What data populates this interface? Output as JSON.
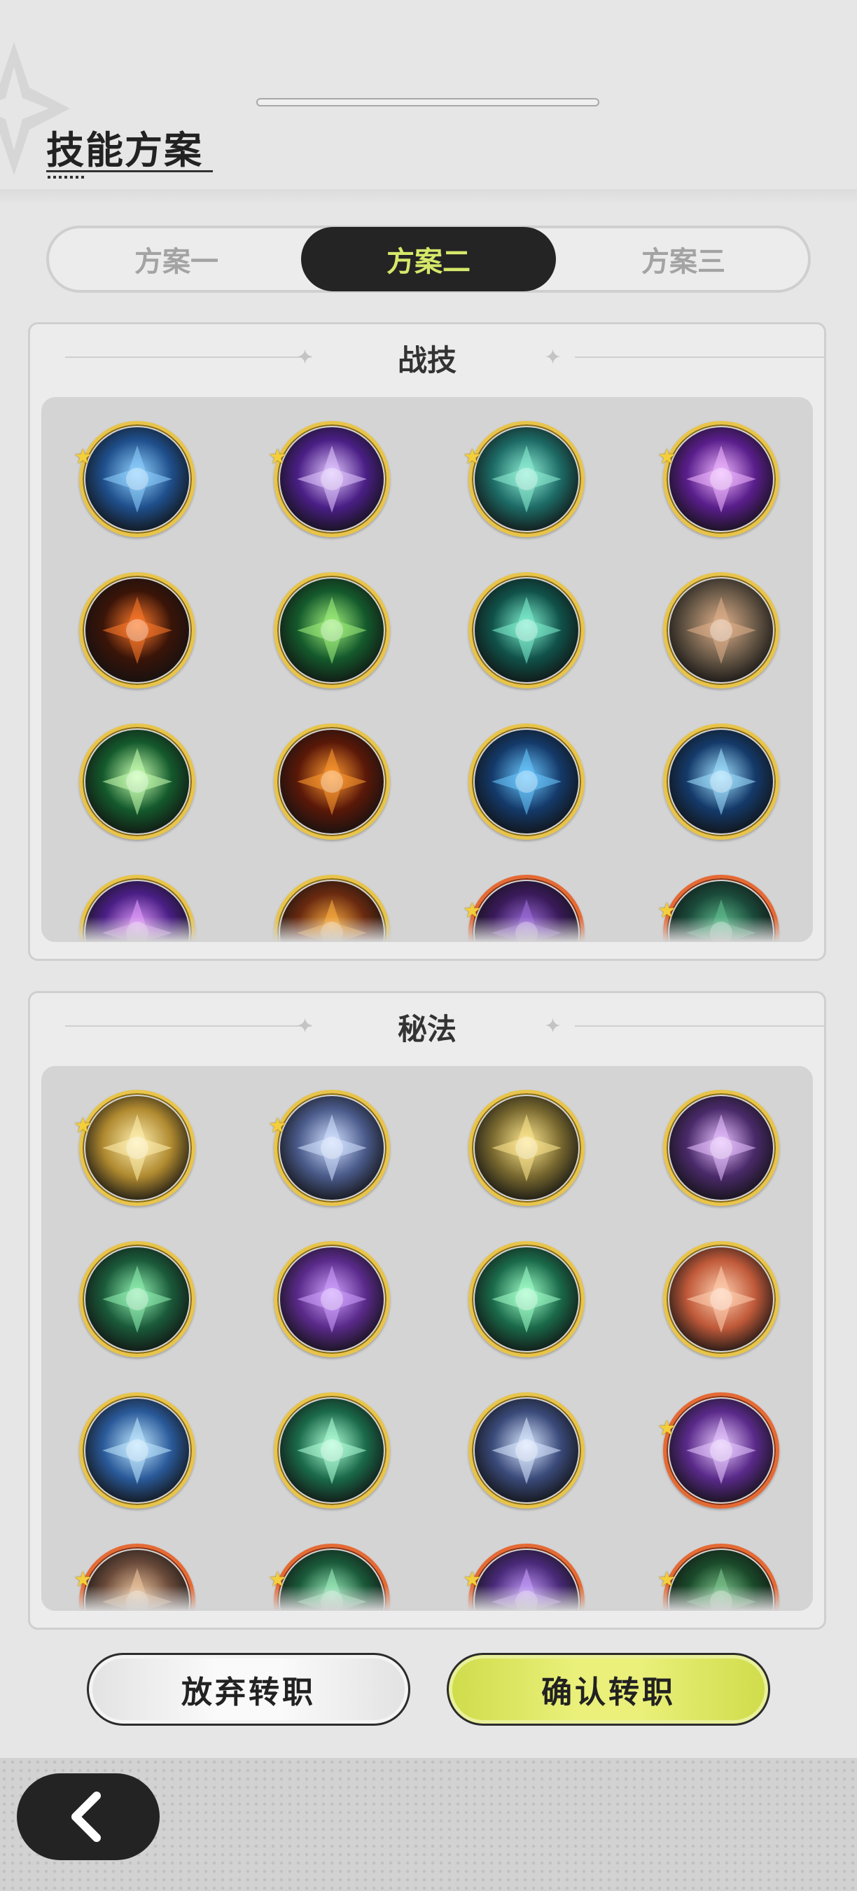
{
  "header": {
    "title": "技能方案"
  },
  "tabs": [
    {
      "label": "方案一",
      "active": false
    },
    {
      "label": "方案二",
      "active": true
    },
    {
      "label": "方案三",
      "active": false
    }
  ],
  "combat": {
    "title": "战技",
    "icons": [
      {
        "name": "ice-burst-skill-icon",
        "starred": true,
        "frame": "gold",
        "bg": "#1f4f8c",
        "fg": "#8fd2ff"
      },
      {
        "name": "purple-star-skill-icon",
        "starred": true,
        "frame": "gold",
        "bg": "#4a1f86",
        "fg": "#e2c6ff"
      },
      {
        "name": "wind-vortex-skill-icon",
        "starred": true,
        "frame": "gold",
        "bg": "#1d6b66",
        "fg": "#8ff0d6"
      },
      {
        "name": "violet-burst-skill-icon",
        "starred": true,
        "frame": "gold",
        "bg": "#5a1e8c",
        "fg": "#f0b6ff"
      },
      {
        "name": "fire-swirl-skill-icon",
        "starred": false,
        "frame": "gold",
        "bg": "#3a1408",
        "fg": "#ff7a2a"
      },
      {
        "name": "green-comet-skill-icon",
        "starred": false,
        "frame": "gold",
        "bg": "#145a2c",
        "fg": "#9ff07a"
      },
      {
        "name": "teal-slash-skill-icon",
        "starred": false,
        "frame": "gold",
        "bg": "#10524a",
        "fg": "#7ff0cf"
      },
      {
        "name": "earth-shield-skill-icon",
        "starred": false,
        "frame": "gold",
        "bg": "#6a5a48",
        "fg": "#e0b08a"
      },
      {
        "name": "heal-cross-skill-icon",
        "starred": false,
        "frame": "gold",
        "bg": "#145a2c",
        "fg": "#c8ffb0"
      },
      {
        "name": "fireball-skill-icon",
        "starred": false,
        "frame": "gold",
        "bg": "#5a1808",
        "fg": "#ff9a30"
      },
      {
        "name": "water-wave-skill-icon",
        "starred": false,
        "frame": "gold",
        "bg": "#143a6a",
        "fg": "#6ac8ff"
      },
      {
        "name": "ice-shard-skill-icon",
        "starred": false,
        "frame": "gold",
        "bg": "#143a6a",
        "fg": "#a0e0ff"
      },
      {
        "name": "purple-flame-skill-icon",
        "starred": false,
        "frame": "gold",
        "bg": "#4a1f86",
        "fg": "#e8a0ff"
      },
      {
        "name": "flame-ring-skill-icon",
        "starred": false,
        "frame": "gold",
        "bg": "#6a2a10",
        "fg": "#ffb040"
      },
      {
        "name": "shadow-orb-skill-icon",
        "starred": true,
        "frame": "orange",
        "bg": "#3a1a5a",
        "fg": "#a070e0"
      },
      {
        "name": "thorn-vine-skill-icon",
        "starred": true,
        "frame": "orange",
        "bg": "#1a4a3a",
        "fg": "#60c090"
      }
    ]
  },
  "secret": {
    "title": "秘法",
    "icons": [
      {
        "name": "golden-rune-secret-icon",
        "starred": true,
        "frame": "gold",
        "bg": "#b08a30",
        "fg": "#fff0b0"
      },
      {
        "name": "crystal-orb-secret-icon",
        "starred": true,
        "frame": "gold",
        "bg": "#4a5a8a",
        "fg": "#d0e0ff"
      },
      {
        "name": "golden-wing-secret-icon",
        "starred": false,
        "frame": "gold",
        "bg": "#7a6a30",
        "fg": "#ffe890"
      },
      {
        "name": "purple-eye-secret-icon",
        "starred": false,
        "frame": "gold",
        "bg": "#4a2a6a",
        "fg": "#e8c0ff"
      },
      {
        "name": "heart-secret-icon",
        "starred": false,
        "frame": "gold",
        "bg": "#1a5a3a",
        "fg": "#90f0b0"
      },
      {
        "name": "purple-swirl-secret-icon",
        "starred": false,
        "frame": "gold",
        "bg": "#5a2a8a",
        "fg": "#d0a0ff"
      },
      {
        "name": "green-clover-secret-icon",
        "starred": false,
        "frame": "gold",
        "bg": "#1a6a4a",
        "fg": "#a0ffc8"
      },
      {
        "name": "fire-figure-secret-icon",
        "starred": false,
        "frame": "gold",
        "bg": "#c05a3a",
        "fg": "#ffd0b0"
      },
      {
        "name": "water-figure-secret-icon",
        "starred": false,
        "frame": "gold",
        "bg": "#2a5a9a",
        "fg": "#c0e8ff"
      },
      {
        "name": "wind-figure-secret-icon",
        "starred": false,
        "frame": "gold",
        "bg": "#1a6a4a",
        "fg": "#b0ffd8"
      },
      {
        "name": "sparkle-secret-icon",
        "starred": false,
        "frame": "gold",
        "bg": "#3a4a7a",
        "fg": "#d8e8ff"
      },
      {
        "name": "purple-gate-secret-icon",
        "starred": true,
        "frame": "orange",
        "bg": "#5a2a8a",
        "fg": "#e8c8ff"
      },
      {
        "name": "beast-secret-icon",
        "starred": true,
        "frame": "orange",
        "bg": "#6a4a3a",
        "fg": "#f0c8a0"
      },
      {
        "name": "emerald-shield-secret-icon",
        "starred": true,
        "frame": "orange",
        "bg": "#1a5a3a",
        "fg": "#a0f0c0"
      },
      {
        "name": "violet-spirit-secret-icon",
        "starred": true,
        "frame": "orange",
        "bg": "#4a2a7a",
        "fg": "#c8a0ff"
      },
      {
        "name": "forest-spirit-secret-icon",
        "starred": true,
        "frame": "orange",
        "bg": "#1a4a2a",
        "fg": "#80c890"
      }
    ]
  },
  "buttons": {
    "cancel": "放弃转职",
    "confirm": "确认转职"
  },
  "colors": {
    "accent": "#d6e86a",
    "gold_frame": "#e8c44a",
    "orange_frame": "#e56a34",
    "dark": "#242424"
  }
}
